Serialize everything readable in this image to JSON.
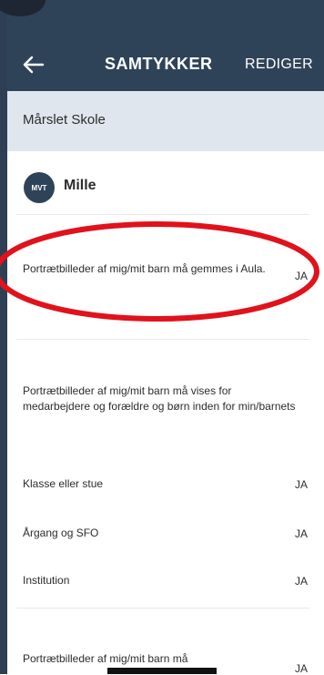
{
  "header": {
    "title": "SAMTYKKER",
    "edit_label": "REDIGER",
    "bg_color": "#2f4358"
  },
  "school": {
    "name": "Mårslet Skole"
  },
  "profile": {
    "initials": "MVT",
    "name": "Mille"
  },
  "consents": [
    {
      "text": "Portrætbilleder af mig/mit barn må gemmes i Aula.",
      "value": "JA"
    },
    {
      "text": "Portrætbilleder af mig/mit barn må vises for medarbejdere og forældre og børn inden for min/barnets"
    },
    {
      "text": "Klasse eller stue",
      "value": "JA"
    },
    {
      "text": "Årgang og SFO",
      "value": "JA"
    },
    {
      "text": "Institution",
      "value": "JA"
    },
    {
      "text": "Portrætbilleder af mig/mit barn må",
      "value": "JA"
    }
  ],
  "highlight": {
    "color": "#e0121b"
  }
}
